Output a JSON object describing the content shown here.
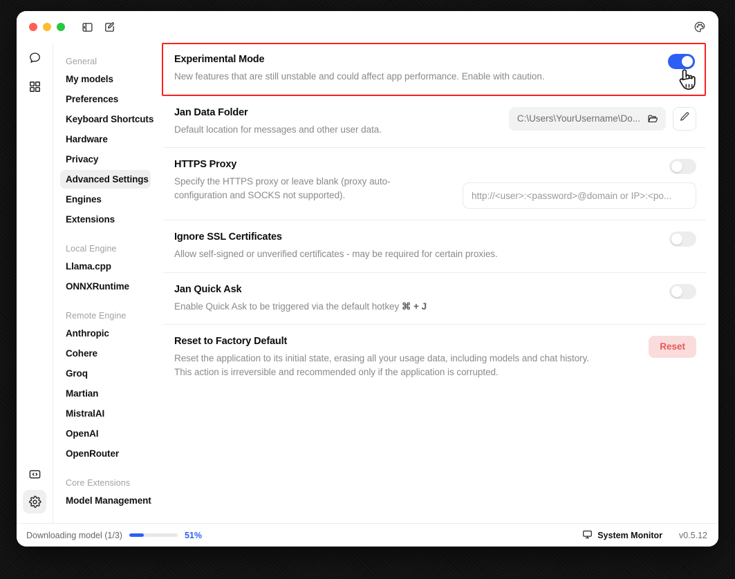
{
  "titlebar": {
    "traffic_lights": [
      "close",
      "minimize",
      "zoom"
    ],
    "left_icons": [
      {
        "name": "toggle-sidebar-icon",
        "label": "Toggle Sidebar"
      },
      {
        "name": "new-chat-icon",
        "label": "New Chat"
      }
    ],
    "right_icon": {
      "name": "palette-icon",
      "label": "Appearance"
    }
  },
  "rail": {
    "top": [
      {
        "name": "chat-icon",
        "label": "Chat"
      },
      {
        "name": "grid-icon",
        "label": "Hub"
      }
    ],
    "bottom": [
      {
        "name": "code-icon",
        "label": "Local API Server",
        "active": false
      },
      {
        "name": "gear-icon",
        "label": "Settings",
        "active": true
      }
    ]
  },
  "sidebar": {
    "groups": [
      {
        "label": "General",
        "items": [
          {
            "label": "My models",
            "active": false
          },
          {
            "label": "Preferences",
            "active": false
          },
          {
            "label": "Keyboard Shortcuts",
            "active": false
          },
          {
            "label": "Hardware",
            "active": false
          },
          {
            "label": "Privacy",
            "active": false
          },
          {
            "label": "Advanced Settings",
            "active": true
          },
          {
            "label": "Engines",
            "active": false
          },
          {
            "label": "Extensions",
            "active": false
          }
        ]
      },
      {
        "label": "Local Engine",
        "items": [
          {
            "label": "Llama.cpp",
            "active": false
          },
          {
            "label": "ONNXRuntime",
            "active": false
          }
        ]
      },
      {
        "label": "Remote Engine",
        "items": [
          {
            "label": "Anthropic",
            "active": false
          },
          {
            "label": "Cohere",
            "active": false
          },
          {
            "label": "Groq",
            "active": false
          },
          {
            "label": "Martian",
            "active": false
          },
          {
            "label": "MistralAI",
            "active": false
          },
          {
            "label": "OpenAI",
            "active": false
          },
          {
            "label": "OpenRouter",
            "active": false
          }
        ]
      },
      {
        "label": "Core Extensions",
        "items": [
          {
            "label": "Model Management",
            "active": false
          }
        ]
      }
    ]
  },
  "settings": {
    "experimental": {
      "title": "Experimental Mode",
      "description": "New features that are still unstable and could affect app performance. Enable with caution.",
      "toggle_state": "on",
      "highlight_color": "#ff1f1f"
    },
    "data_folder": {
      "title": "Jan Data Folder",
      "description": "Default location for messages and other user data.",
      "path_value": "C:\\Users\\YourUsername\\Do...",
      "folder_icon": "folder-open-icon",
      "edit_icon": "pencil-icon"
    },
    "https_proxy": {
      "title": "HTTPS Proxy",
      "description": "Specify the HTTPS proxy or leave blank (proxy auto-configuration and SOCKS not supported).",
      "toggle_state": "off",
      "input_placeholder": "http://<user>:<password>@domain or IP>:<po...",
      "input_value": ""
    },
    "ignore_ssl": {
      "title": "Ignore SSL Certificates",
      "description": "Allow self-signed or unverified certificates - may be required for certain proxies.",
      "toggle_state": "off"
    },
    "quick_ask": {
      "title": "Jan Quick Ask",
      "description_prefix": "Enable Quick Ask to be triggered via the default hotkey ",
      "hotkey": "⌘ + J",
      "toggle_state": "off"
    },
    "factory_reset": {
      "title": "Reset to Factory Default",
      "description": "Reset the application to its initial state, erasing all your usage data, including models and chat history. This action is irreversible and recommended only if the application is corrupted.",
      "button_label": "Reset",
      "button_bg": "#fadcdc",
      "button_fg": "#e8575b"
    }
  },
  "statusbar": {
    "download_text": "Downloading model (1/3)",
    "progress_percent": "51%",
    "progress_fill_ratio": 0.3,
    "progress_color": "#2c5ff6",
    "system_monitor_label": "System Monitor",
    "system_monitor_icon": "monitor-icon",
    "version": "v0.5.12"
  },
  "cursor": {
    "type": "pointing-hand-cursor"
  }
}
